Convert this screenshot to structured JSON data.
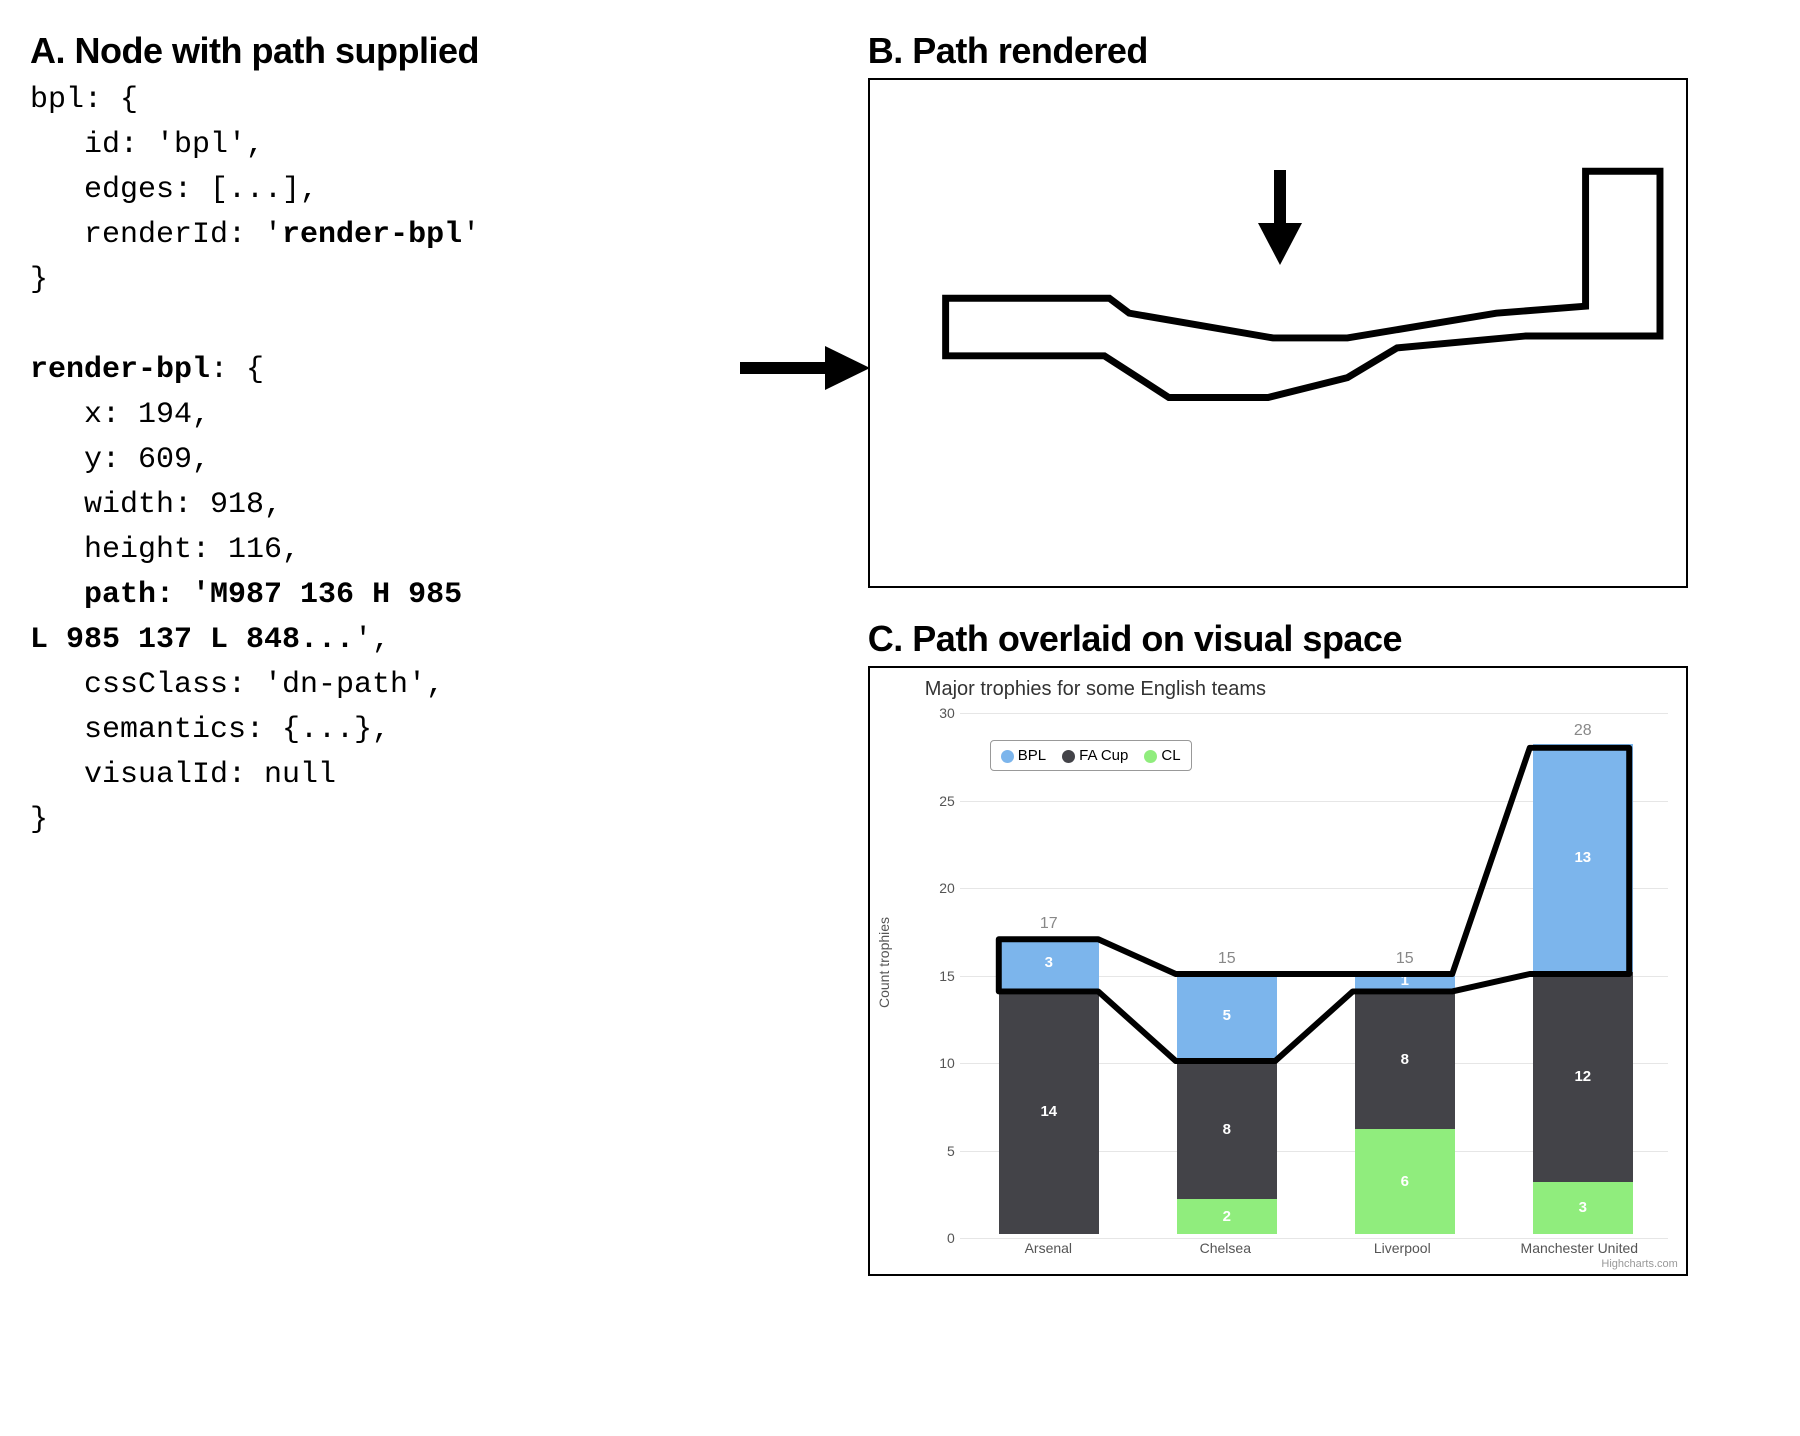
{
  "panelA": {
    "heading": "A. Node with path supplied",
    "code_lines": [
      {
        "t": "bpl: {",
        "b": false
      },
      {
        "t": "   id: 'bpl',",
        "b": false
      },
      {
        "t": "   edges: [...],",
        "b": false
      },
      {
        "t": "   renderId: '",
        "b": false,
        "suffix": "render-bpl",
        "suffix_b": true,
        "tail": "'"
      },
      {
        "t": "}",
        "b": false
      },
      {
        "t": "",
        "b": false
      },
      {
        "t": "render-bpl",
        "b": true,
        "tail": ": {"
      },
      {
        "t": "   x: 194,",
        "b": false
      },
      {
        "t": "   y: 609,",
        "b": false
      },
      {
        "t": "   width: 918,",
        "b": false
      },
      {
        "t": "   height: 116,",
        "b": false
      },
      {
        "t": "   ",
        "b": false,
        "suffix": "path: 'M987 136 H 985",
        "suffix_b": true
      },
      {
        "t": "L 985 137 L 848...",
        "b": true,
        "tail": "',"
      },
      {
        "t": "   cssClass: 'dn-path',",
        "b": false
      },
      {
        "t": "   semantics: {...},",
        "b": false
      },
      {
        "t": "   visualId: null",
        "b": false
      },
      {
        "t": "}",
        "b": false
      }
    ]
  },
  "panelB": {
    "heading": "B. Path rendered"
  },
  "panelC": {
    "heading": "C. Path overlaid on visual space",
    "credit": "Highcharts.com"
  },
  "chart_data": {
    "type": "bar",
    "stacked": true,
    "title": "Major trophies for some English teams",
    "ylabel": "Count trophies",
    "ylim": [
      0,
      30
    ],
    "yticks": [
      0,
      5,
      10,
      15,
      20,
      25,
      30
    ],
    "categories": [
      "Arsenal",
      "Chelsea",
      "Liverpool",
      "Manchester United"
    ],
    "series": [
      {
        "name": "BPL",
        "color": "#7cb5ec",
        "values": [
          3,
          5,
          1,
          13
        ]
      },
      {
        "name": "FA Cup",
        "color": "#434348",
        "values": [
          14,
          8,
          8,
          12
        ]
      },
      {
        "name": "CL",
        "color": "#90ed7d",
        "values": [
          0,
          2,
          6,
          3
        ]
      }
    ],
    "totals": [
      17,
      15,
      15,
      28
    ]
  }
}
